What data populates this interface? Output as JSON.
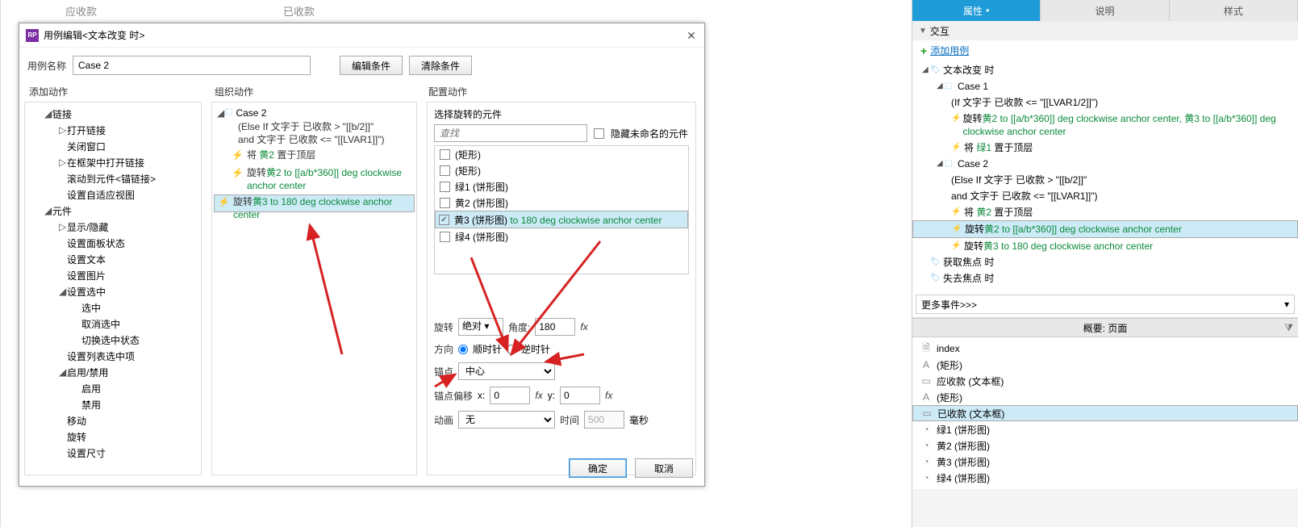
{
  "bg": {
    "t1": "应收款",
    "t2": "已收款"
  },
  "dialog": {
    "title": "用例编辑<文本改变 时>",
    "nameLabel": "用例名称",
    "caseName": "Case 2",
    "editCond": "编辑条件",
    "clearCond": "清除条件",
    "col1Title": "添加动作",
    "col2Title": "组织动作",
    "col3Title": "配置动作",
    "ok": "确定",
    "cancel": "取消"
  },
  "addTree": [
    {
      "lvl": 0,
      "caret": "◢",
      "text": "链接"
    },
    {
      "lvl": 1,
      "caret": "▷",
      "text": "打开链接"
    },
    {
      "lvl": 1,
      "caret": "",
      "text": "关闭窗口"
    },
    {
      "lvl": 1,
      "caret": "▷",
      "text": "在框架中打开链接"
    },
    {
      "lvl": 1,
      "caret": "",
      "text": "滚动到元件<锚链接>"
    },
    {
      "lvl": 1,
      "caret": "",
      "text": "设置自适应视图"
    },
    {
      "lvl": 0,
      "caret": "◢",
      "text": "元件"
    },
    {
      "lvl": 1,
      "caret": "▷",
      "text": "显示/隐藏"
    },
    {
      "lvl": 1,
      "caret": "",
      "text": "设置面板状态"
    },
    {
      "lvl": 1,
      "caret": "",
      "text": "设置文本"
    },
    {
      "lvl": 1,
      "caret": "",
      "text": "设置图片"
    },
    {
      "lvl": 1,
      "caret": "◢",
      "text": "设置选中"
    },
    {
      "lvl": 2,
      "caret": "",
      "text": "选中"
    },
    {
      "lvl": 2,
      "caret": "",
      "text": "取消选中"
    },
    {
      "lvl": 2,
      "caret": "",
      "text": "切换选中状态"
    },
    {
      "lvl": 1,
      "caret": "",
      "text": "设置列表选中项"
    },
    {
      "lvl": 1,
      "caret": "◢",
      "text": "启用/禁用"
    },
    {
      "lvl": 2,
      "caret": "",
      "text": "启用"
    },
    {
      "lvl": 2,
      "caret": "",
      "text": "禁用"
    },
    {
      "lvl": 1,
      "caret": "",
      "text": "移动"
    },
    {
      "lvl": 1,
      "caret": "",
      "text": "旋转"
    },
    {
      "lvl": 1,
      "caret": "",
      "text": "设置尺寸"
    }
  ],
  "org": {
    "caseName": "Case 2",
    "cond1": "(Else If 文字于 已收款 > \"[[b/2]]\"",
    "cond2": "and 文字于 已收款 <= \"[[LVAR1]]\")",
    "a1_pre": "将 ",
    "a1_mid": "黄2",
    "a1_post": " 置于顶层",
    "a2_pre": "旋转",
    "a2_mid": "黄2 to [[a/b*360]] deg clockwise anchor center",
    "a3_pre": "旋转",
    "a3_mid": "黄3 to 180 deg clockwise anchor center"
  },
  "cfg": {
    "selTitle": "选择旋转的元件",
    "searchPh": "查找",
    "hideUnnamed": "隐藏未命名的元件",
    "items": [
      {
        "chk": false,
        "label": "(矩形)",
        "extra": ""
      },
      {
        "chk": false,
        "label": "(矩形)",
        "extra": ""
      },
      {
        "chk": false,
        "label": "绿1 (饼形图)",
        "extra": ""
      },
      {
        "chk": false,
        "label": "黄2 (饼形图)",
        "extra": ""
      },
      {
        "chk": true,
        "label": "黄3 (饼形图)",
        "extra": " to 180 deg clockwise anchor center",
        "sel": true
      },
      {
        "chk": false,
        "label": "绿4 (饼形图)",
        "extra": ""
      }
    ],
    "rotLabel": "旋转",
    "rotMode": "绝对 ▾",
    "angLabel": "角度:",
    "angVal": "180",
    "dirLabel": "方向",
    "cw": "顺时针",
    "ccw": "逆时针",
    "anchorLabel": "锚点",
    "anchorVal": "中心",
    "offLabel": "锚点偏移",
    "x": "0",
    "y": "0",
    "animLabel": "动画",
    "animVal": "无",
    "timeLabel": "时间",
    "timeVal": "500",
    "ms": "毫秒"
  },
  "tabs": {
    "p1": "属性",
    "p2": "说明",
    "p3": "样式"
  },
  "interHead": "交互",
  "addCase": "添加用例",
  "inter": {
    "ev1": "文本改变 时",
    "c1": "Case 1",
    "c1cond": "(If 文字于 已收款 <= \"[[LVAR1/2]]\")",
    "c1a1_pre": "旋转",
    "c1a1_mid": "黄2 to [[a/b*360]] deg clockwise anchor center, 黄3 to [[a/b*360]] deg clockwise anchor center",
    "c1a2_pre": "将 ",
    "c1a2_mid": "绿1",
    "c1a2_post": " 置于顶层",
    "c2": "Case 2",
    "c2cond": "(Else If 文字于 已收款 > \"[[b/2]]\"",
    "c2cond2": "and 文字于 已收款 <= \"[[LVAR1]]\")",
    "c2a1_pre": "将 ",
    "c2a1_mid": "黄2",
    "c2a1_post": " 置于顶层",
    "c2a2_pre": "旋转",
    "c2a2_mid": "黄2 to [[a/b*360]] deg clockwise anchor center",
    "c2a3_pre": "旋转",
    "c2a3_mid": "黄3 to 180 deg clockwise anchor center",
    "ev2": "获取焦点 时",
    "ev3": "失去焦点 时"
  },
  "moreEvents": "更多事件>>>",
  "overviewTitle": "概要: 页面",
  "outline": [
    {
      "ico": "🗎",
      "text": "index",
      "sel": false
    },
    {
      "ico": "A",
      "text": "(矩形)",
      "sel": false
    },
    {
      "ico": "▭",
      "text": "应收款 (文本框)",
      "sel": false
    },
    {
      "ico": "A",
      "text": "(矩形)",
      "sel": false
    },
    {
      "ico": "▭",
      "text": "已收款 (文本框)",
      "sel": true
    },
    {
      "ico": "◔",
      "text": "绿1 (饼形图)",
      "sel": false
    },
    {
      "ico": "◔",
      "text": "黄2 (饼形图)",
      "sel": false
    },
    {
      "ico": "◔",
      "text": "黄3 (饼形图)",
      "sel": false
    },
    {
      "ico": "◔",
      "text": "绿4 (饼形图)",
      "sel": false
    }
  ]
}
